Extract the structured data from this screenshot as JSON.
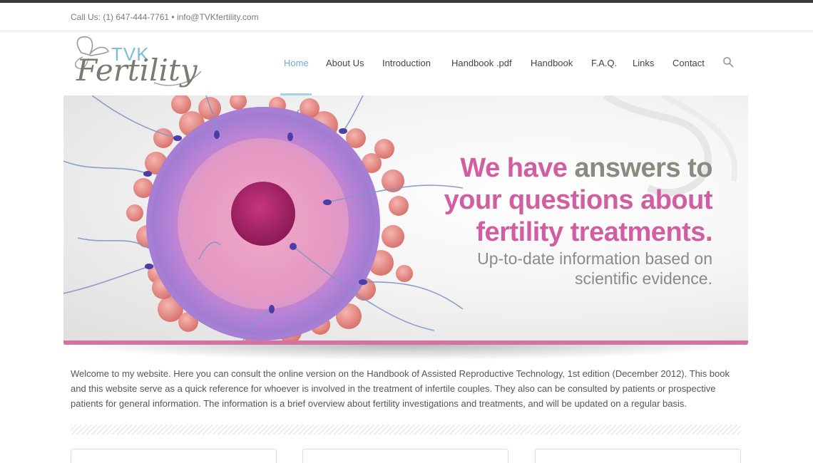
{
  "header": {
    "contact": "Call Us: (1) 647-444-7761 • info@TVKfertility.com"
  },
  "logo": {
    "line1": "TVK",
    "line2": "Fertility"
  },
  "nav": {
    "items": [
      {
        "label": "Home"
      },
      {
        "label": "About Us"
      },
      {
        "label": "Introduction"
      },
      {
        "label": "Handbook .pdf"
      },
      {
        "label": "Handbook"
      },
      {
        "label": "F.A.Q."
      },
      {
        "label": "Links"
      },
      {
        "label": "Contact"
      }
    ],
    "active_item": "Home",
    "search_icon": "search-icon"
  },
  "hero": {
    "headline_pink_1": "We have ",
    "headline_gray": "answers to",
    "headline_line2": "your questions about",
    "headline_line3": "fertility treatments.",
    "subline_1": "Up-to-date information based on",
    "subline_2": "scientific evidence."
  },
  "intro": {
    "text": "Welcome to my website. Here you can consult the online version on the Handbook of Assisted Reproductive Technology, 1st edition (December 2012). This book and this website serve as a quick reference for whoever is involved in the treatment of infertile couples. They also can be consulted by patients or prospective patients for general information. The information is a brief overview about fertility investigations and treatments, and will be updated on a regular basis."
  },
  "colors": {
    "accent_pink": "#d15ea0",
    "nav_active": "#6aaed0",
    "headline_gray": "#8a8a80"
  }
}
